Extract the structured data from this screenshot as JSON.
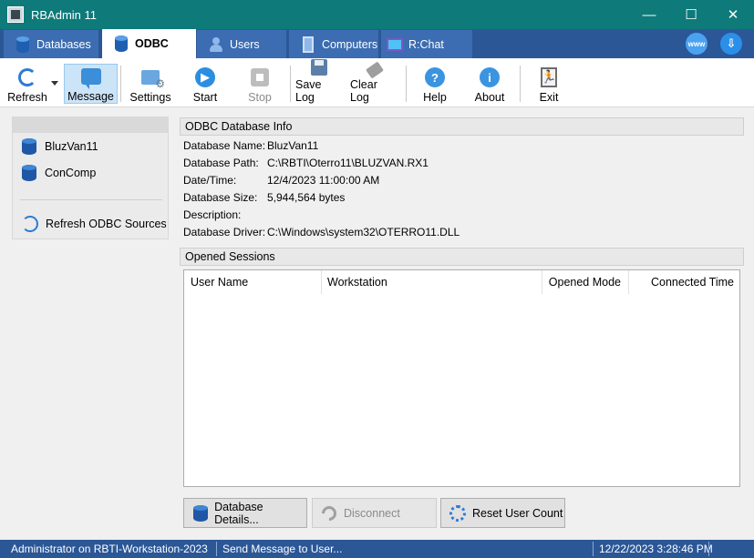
{
  "window": {
    "title": "RBAdmin 11"
  },
  "tabs": [
    {
      "label": "Databases"
    },
    {
      "label": "ODBC"
    },
    {
      "label": "Users"
    },
    {
      "label": "Computers"
    },
    {
      "label": "R:Chat"
    }
  ],
  "tabs_right": {
    "web_label": "www"
  },
  "toolbar": {
    "refresh": "Refresh",
    "message": "Message",
    "settings": "Settings",
    "start": "Start",
    "stop": "Stop",
    "save_log": "Save Log",
    "clear_log": "Clear Log",
    "help": "Help",
    "about": "About",
    "exit": "Exit"
  },
  "sidebar": {
    "items": [
      {
        "label": "BluzVan11"
      },
      {
        "label": "ConComp"
      }
    ],
    "refresh_label": "Refresh ODBC Sources"
  },
  "info": {
    "header": "ODBC Database Info",
    "rows": [
      {
        "label": "Database Name:",
        "value": "BluzVan11"
      },
      {
        "label": "Database Path:",
        "value": "C:\\RBTI\\Oterro11\\BLUZVAN.RX1"
      },
      {
        "label": "Date/Time:",
        "value": "12/4/2023 11:00:00 AM"
      },
      {
        "label": "Database Size:",
        "value": "5,944,564 bytes"
      },
      {
        "label": "Description:",
        "value": ""
      },
      {
        "label": "Database Driver:",
        "value": "C:\\Windows\\system32\\OTERRO11.DLL"
      }
    ]
  },
  "sessions": {
    "header": "Opened Sessions",
    "columns": [
      "User Name",
      "Workstation",
      "Opened Mode",
      "Connected Time"
    ]
  },
  "buttons": {
    "details": "Database Details...",
    "disconnect": "Disconnect",
    "reset": "Reset User Count"
  },
  "status": {
    "user": "Administrator on RBTI-Workstation-2023",
    "message": "Send Message to User...",
    "datetime": "12/22/2023 3:28:46 PM"
  },
  "colors": {
    "titlebar": "#0e7a7a",
    "tabsbar": "#2b5797",
    "statusbar": "#2b5797",
    "accent": "#2c7ad6"
  }
}
